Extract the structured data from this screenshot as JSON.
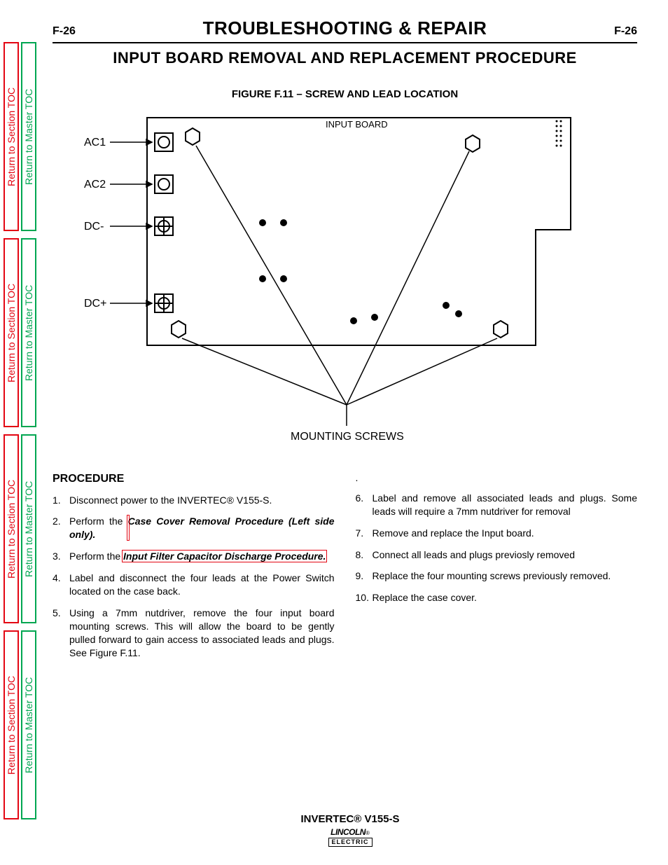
{
  "sidebar": {
    "section_label": "Return to Section TOC",
    "master_label": "Return to Master TOC"
  },
  "header": {
    "page_left": "F-26",
    "section_title": "TROUBLESHOOTING & REPAIR",
    "page_right": "F-26",
    "subsection_title": "INPUT BOARD REMOVAL AND REPLACEMENT PROCEDURE"
  },
  "figure": {
    "caption": "FIGURE F.11 – SCREW AND LEAD LOCATION",
    "labels": {
      "ac1": "AC1",
      "ac2": "AC2",
      "dc_minus": "DC-",
      "dc_plus": "DC+",
      "input_board": "INPUT BOARD",
      "mounting_screws": "MOUNTING SCREWS"
    }
  },
  "procedure": {
    "heading": "PROCEDURE",
    "step1": "Disconnect power to the INVERTEC® V155-S.",
    "step2_a": "Perform the ",
    "step2_link": "Case Cover Removal Procedure (Left side only).",
    "step3_a": "Perform the ",
    "step3_link": "Input Filter Capacitor Discharge Procedure.",
    "step4": "Label and disconnect the four leads at the Power Switch located on the case back.",
    "step5": "Using a 7mm nutdriver, remove the four input board mounting screws. This will allow the board to be gently pulled forward to gain access to associated leads and plugs. See Figure F.11.",
    "dot": ".",
    "step6": "Label and remove all associated leads and plugs. Some leads will require a 7mm nutdriver for removal",
    "step7": "Remove and replace the Input board.",
    "step8": "Connect all leads and plugs previosly removed",
    "step9": "Replace the four mounting screws previously removed.",
    "step10": "Replace the case cover."
  },
  "footer": {
    "product": "INVERTEC® V155-S",
    "logo_top": "LINCOLN",
    "logo_bot": "ELECTRIC"
  }
}
